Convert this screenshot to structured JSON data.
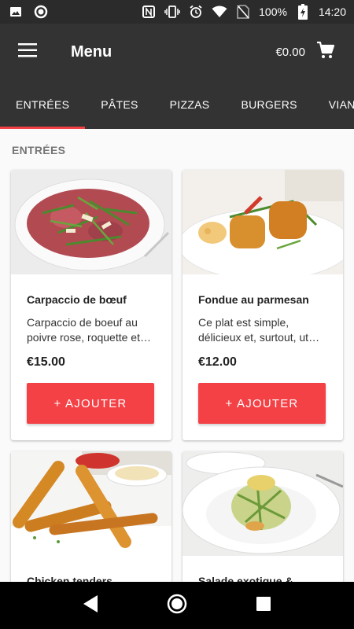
{
  "status_bar": {
    "battery": "100%",
    "time": "14:20",
    "icons": [
      "image-icon",
      "circle-icon",
      "nfc-icon",
      "vibrate-icon",
      "alarm-icon",
      "wifi-icon",
      "no-sim-icon",
      "battery-charging-icon"
    ]
  },
  "app_bar": {
    "title": "Menu",
    "cart_amount": "€0.00",
    "menu_icon": "hamburger-icon",
    "cart_icon": "cart-icon"
  },
  "tabs": [
    {
      "label": "ENTRÉES",
      "active": true
    },
    {
      "label": "PÂTES",
      "active": false
    },
    {
      "label": "PIZZAS",
      "active": false
    },
    {
      "label": "BURGERS",
      "active": false
    },
    {
      "label": "VIANDES",
      "active": false
    }
  ],
  "section": {
    "title": "ENTRÉES"
  },
  "products": [
    {
      "title": "Carpaccio de bœuf",
      "description": "Carpaccio de boeuf au poivre rose, roquette et copeaux de parmesan",
      "price": "€15.00",
      "button": "+ AJOUTER"
    },
    {
      "title": "Fondue au parmesan",
      "description": "Ce plat est simple, délicieux et, surtout, ut…",
      "price": "€12.00",
      "button": "+ AJOUTER"
    },
    {
      "title": "Chicken tenders",
      "description": "",
      "price": "",
      "button": ""
    },
    {
      "title": "Salade exotique & …",
      "description": "",
      "price": "",
      "button": ""
    }
  ],
  "colors": {
    "app_bar": "#333333",
    "accent": "#f44146",
    "status_bar": "#2b2b2b"
  },
  "nav_bar": {
    "icons": [
      "back-icon",
      "home-icon",
      "recents-icon"
    ]
  }
}
